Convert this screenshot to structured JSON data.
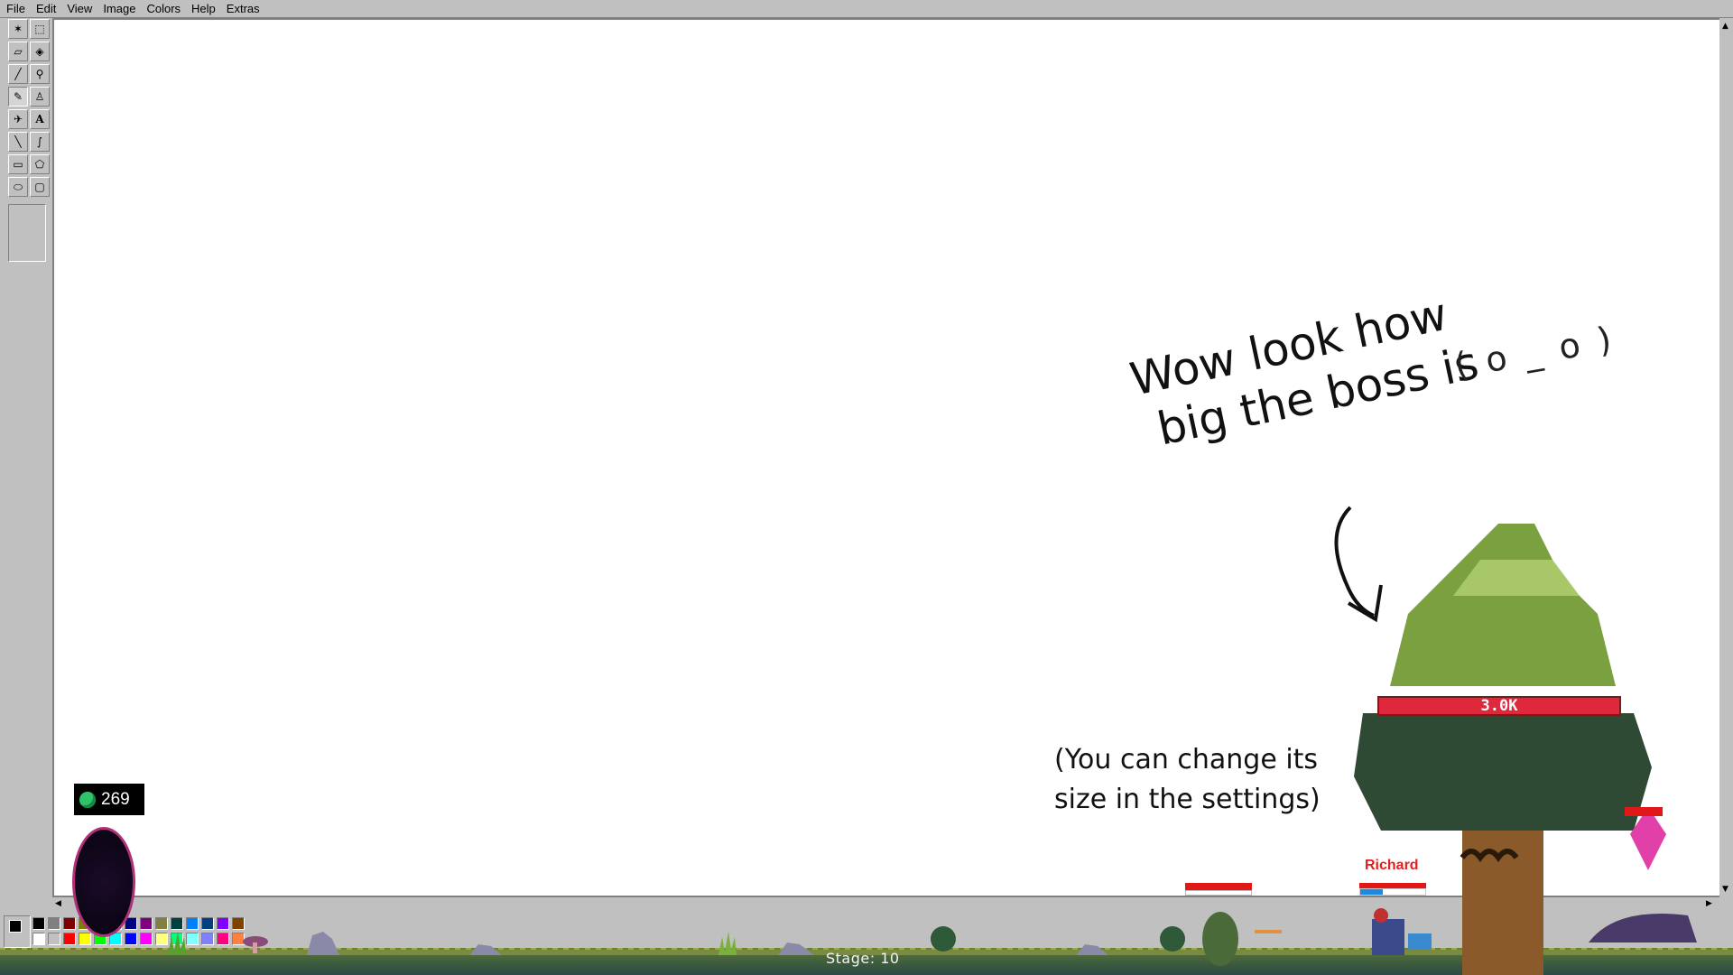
{
  "menu": [
    "File",
    "Edit",
    "View",
    "Image",
    "Colors",
    "Help",
    "Extras"
  ],
  "tools": [
    {
      "name": "free-select-icon",
      "glyph": "✶"
    },
    {
      "name": "rect-select-icon",
      "glyph": "⬚"
    },
    {
      "name": "eraser-icon",
      "glyph": "▱"
    },
    {
      "name": "fill-bucket-icon",
      "glyph": "◈"
    },
    {
      "name": "color-picker-icon",
      "glyph": "╱"
    },
    {
      "name": "magnifier-icon",
      "glyph": "⚲"
    },
    {
      "name": "pencil-icon",
      "glyph": "✎"
    },
    {
      "name": "brush-icon",
      "glyph": "♙"
    },
    {
      "name": "airbrush-icon",
      "glyph": "✈"
    },
    {
      "name": "text-icon",
      "glyph": "A"
    },
    {
      "name": "line-icon",
      "glyph": "╲"
    },
    {
      "name": "curve-icon",
      "glyph": "∫"
    },
    {
      "name": "rectangle-icon",
      "glyph": "▭"
    },
    {
      "name": "polygon-icon",
      "glyph": "⬠"
    },
    {
      "name": "ellipse-icon",
      "glyph": "⬭"
    },
    {
      "name": "rounded-rect-icon",
      "glyph": "▢"
    }
  ],
  "palette": {
    "primary": "#000000",
    "secondary": "#ffffff",
    "colors_top": [
      "#000000",
      "#808080",
      "#800000",
      "#808000",
      "#008000",
      "#008080",
      "#000080",
      "#800080",
      "#808040",
      "#004040",
      "#0080ff",
      "#004080",
      "#8000ff",
      "#804000"
    ],
    "colors_bottom": [
      "#ffffff",
      "#c0c0c0",
      "#ff0000",
      "#ffff00",
      "#00ff00",
      "#00ffff",
      "#0000ff",
      "#ff00ff",
      "#ffff80",
      "#00ff80",
      "#80ffff",
      "#8080ff",
      "#ff0080",
      "#ff8040"
    ]
  },
  "game": {
    "currency_icon": "green-gem-icon",
    "currency": "269",
    "stage_label": "Stage: 10",
    "boss_hp_label": "3.0K",
    "player_name": "Richard",
    "player_mana_fraction": 0.35,
    "annotation_main_line1": "Wow look how",
    "annotation_main_line2": "big the boss is",
    "annotation_face": "( o _ o )",
    "annotation_note_line1": "(You can change its",
    "annotation_note_line2": "size in the settings)"
  },
  "colors": {
    "boss_hp": "#e0283c",
    "hp_red": "#e01818",
    "mana_blue": "#1e88e5",
    "player_name": "#e02020"
  }
}
